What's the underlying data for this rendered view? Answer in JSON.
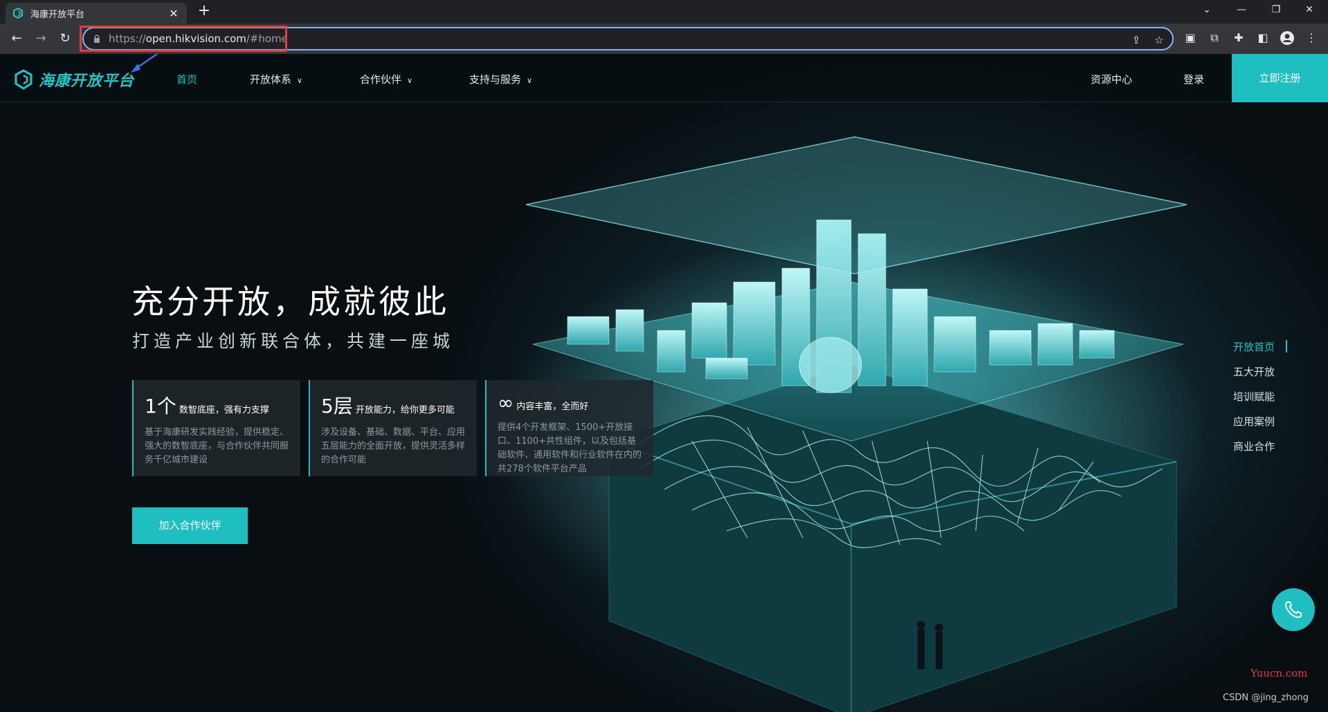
{
  "browser": {
    "tab_title": "海康开放平台",
    "tab_close": "✕",
    "new_tab": "+",
    "url_scheme": "https://",
    "url_host": "open.hikvision.com",
    "url_path": "/#home"
  },
  "site": {
    "logo_text": "海康开放平台",
    "nav": {
      "home": "首页",
      "open_system": "开放体系",
      "partners": "合作伙伴",
      "support": "支持与服务",
      "resources": "资源中心",
      "login": "登录",
      "register": "立即注册"
    },
    "hero": {
      "title": "充分开放，成就彼此",
      "subtitle": "打造产业创新联合体，共建一座城",
      "cards": [
        {
          "big": "1个",
          "title": "数智底座，强有力支撑",
          "body": "基于海康研发实践经验，提供稳定、强大的数智底座，与合作伙伴共同服务千亿城市建设"
        },
        {
          "big": "5层",
          "title": "开放能力，给你更多可能",
          "body": "涉及设备、基础、数据、平台、应用五层能力的全面开放，提供灵活多样的合作可能"
        },
        {
          "big": "∞",
          "title": "内容丰富，全而好",
          "body": "提供4个开发框架、1500+开放接口、1100+共性组件，以及包括基础软件、通用软件和行业软件在内的共278个软件平台产品"
        }
      ],
      "join_button": "加入合作伙伴"
    },
    "side_nav": [
      "开放首页",
      "五大开放",
      "培训赋能",
      "应用案例",
      "商业合作"
    ],
    "watermark_yuucn": "Yuucn.com",
    "watermark_csdn": "CSDN @jing_zhong"
  },
  "colors": {
    "accent": "#1fbec1",
    "highlight_box": "#e0413a",
    "background": "#0b1115"
  }
}
